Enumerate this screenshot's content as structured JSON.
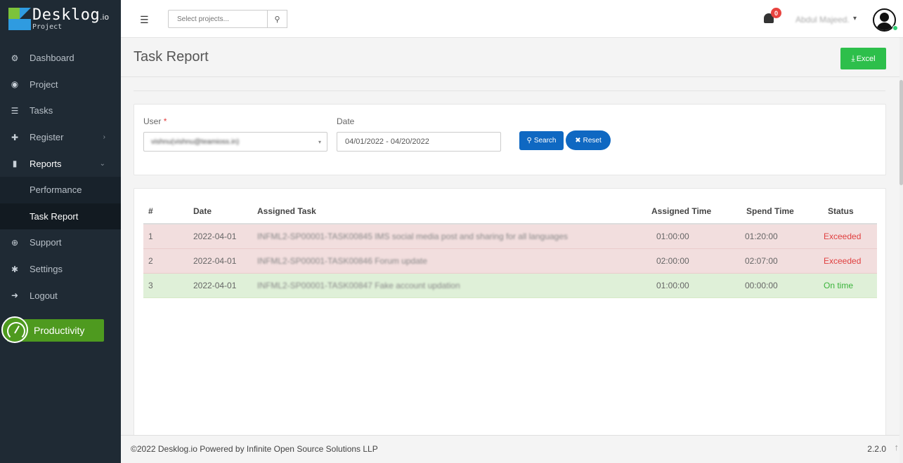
{
  "brand": {
    "name": "Desklog",
    "suffix": ".io",
    "sub": "Project"
  },
  "sidebar": {
    "items": [
      {
        "label": "Dashboard",
        "icon": "dashboard-icon",
        "glyph": "⚙"
      },
      {
        "label": "Project",
        "icon": "project-icon",
        "glyph": "◉"
      },
      {
        "label": "Tasks",
        "icon": "tasks-icon",
        "glyph": "☰"
      },
      {
        "label": "Register",
        "icon": "plus-icon",
        "glyph": "✚",
        "chevron": "›"
      },
      {
        "label": "Reports",
        "icon": "bar-chart-icon",
        "glyph": "▮",
        "chevron": "⌄"
      }
    ],
    "sub_items": [
      {
        "label": "Performance"
      },
      {
        "label": "Task Report"
      }
    ],
    "bottom_items": [
      {
        "label": "Support",
        "icon": "support-icon",
        "glyph": "⊕"
      },
      {
        "label": "Settings",
        "icon": "settings-icon",
        "glyph": "✱"
      },
      {
        "label": "Logout",
        "icon": "logout-icon",
        "glyph": "➜"
      }
    ],
    "productivity_label": "Productivity"
  },
  "topbar": {
    "search_placeholder": "Select projects...",
    "notification_count": "0",
    "user_name": "Abdul Majeed.",
    "user_caret": "▾"
  },
  "page": {
    "title": "Task Report",
    "excel_label": "Excel"
  },
  "filter": {
    "user_label": "User",
    "user_required": "*",
    "user_value": "vishnu(vishnu@teamioss.in)",
    "date_label": "Date",
    "date_value": "04/01/2022 - 04/20/2022",
    "search_label": "Search",
    "reset_label": "Reset"
  },
  "table": {
    "headers": [
      "#",
      "Date",
      "Assigned Task",
      "Assigned Time",
      "Spend Time",
      "Status"
    ],
    "rows": [
      {
        "num": "1",
        "date": "2022-04-01",
        "task": "INFML2-SP00001-TASK00845 IMS social media post and sharing for all languages",
        "assigned": "01:00:00",
        "spend": "01:20:00",
        "status": "Exceeded"
      },
      {
        "num": "2",
        "date": "2022-04-01",
        "task": "INFML2-SP00001-TASK00846 Forum update",
        "assigned": "02:00:00",
        "spend": "02:07:00",
        "status": "Exceeded"
      },
      {
        "num": "3",
        "date": "2022-04-01",
        "task": "INFML2-SP00001-TASK00847 Fake account updation",
        "assigned": "01:00:00",
        "spend": "00:00:00",
        "status": "On time"
      }
    ]
  },
  "footer": {
    "text": "©2022 Desklog.io Powered by Infinite Open Source Solutions LLP",
    "version": "2.2.0"
  },
  "colors": {
    "sidebar_bg": "#1f2a34",
    "excel_green": "#2dbf4b",
    "primary_blue": "#0f68c2",
    "exceeded_row": "#f2dede",
    "ontime_row": "#dff0d8",
    "productivity_green": "#4e9a1f"
  }
}
